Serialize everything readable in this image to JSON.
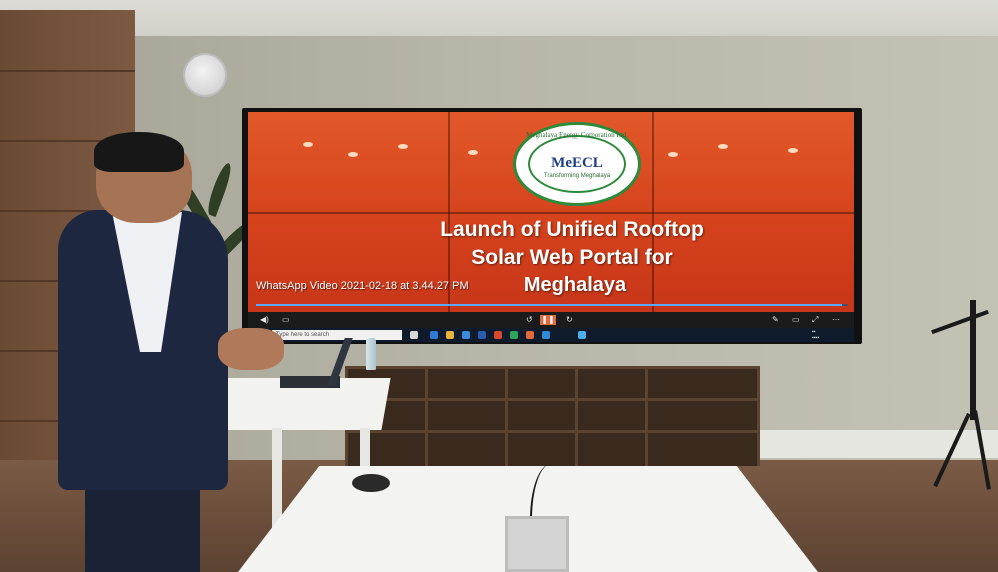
{
  "screen": {
    "logo": {
      "arc_text": "Meghalaya Energy Corporation Ltd.",
      "name": "MeECL",
      "tagline": "Transforming Meghalaya"
    },
    "headline": {
      "line1": "Launch of Unified Rooftop",
      "line2": "Solar Web Portal for",
      "line3": "Meghalaya"
    },
    "video_caption": "WhatsApp Video 2021-02-18 at 3.44.27 PM",
    "playback_progress": 0.99,
    "taskbar": {
      "search_placeholder": "Type here to search"
    }
  },
  "colors": {
    "slide_red": "#d5421c",
    "logo_green": "#2d8a3a",
    "logo_blue": "#1f3f86",
    "progress_blue": "#5aa7ff"
  }
}
